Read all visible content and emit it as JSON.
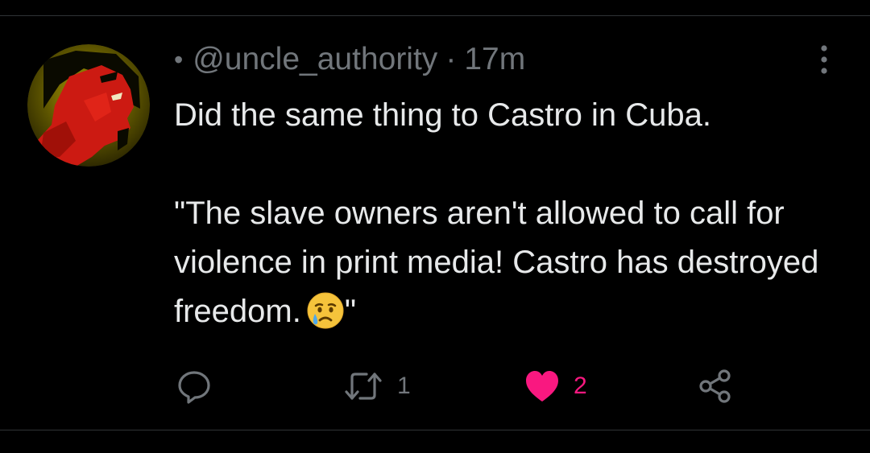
{
  "tweet": {
    "bullet": "•",
    "handle": "@uncle_authority",
    "separator": "·",
    "time": "17m",
    "line1": "Did the same thing to Castro in Cuba.",
    "quote_part1": "\"The slave owners aren't allowed to call for violence in print media!  Castro has destroyed freedom.",
    "quote_end": "\"",
    "emoji": "crying-face-emoji"
  },
  "actions": {
    "reply": {
      "icon": "reply-icon",
      "count": ""
    },
    "retweet": {
      "icon": "retweet-icon",
      "count": "1"
    },
    "like": {
      "icon": "heart-icon",
      "count": "2",
      "color": "#f91880",
      "liked": true
    },
    "share": {
      "icon": "share-icon",
      "count": ""
    }
  },
  "colors": {
    "background": "#000000",
    "text": "#e7e9ea",
    "muted": "#71767b",
    "like": "#f91880",
    "divider": "#2f3336"
  }
}
